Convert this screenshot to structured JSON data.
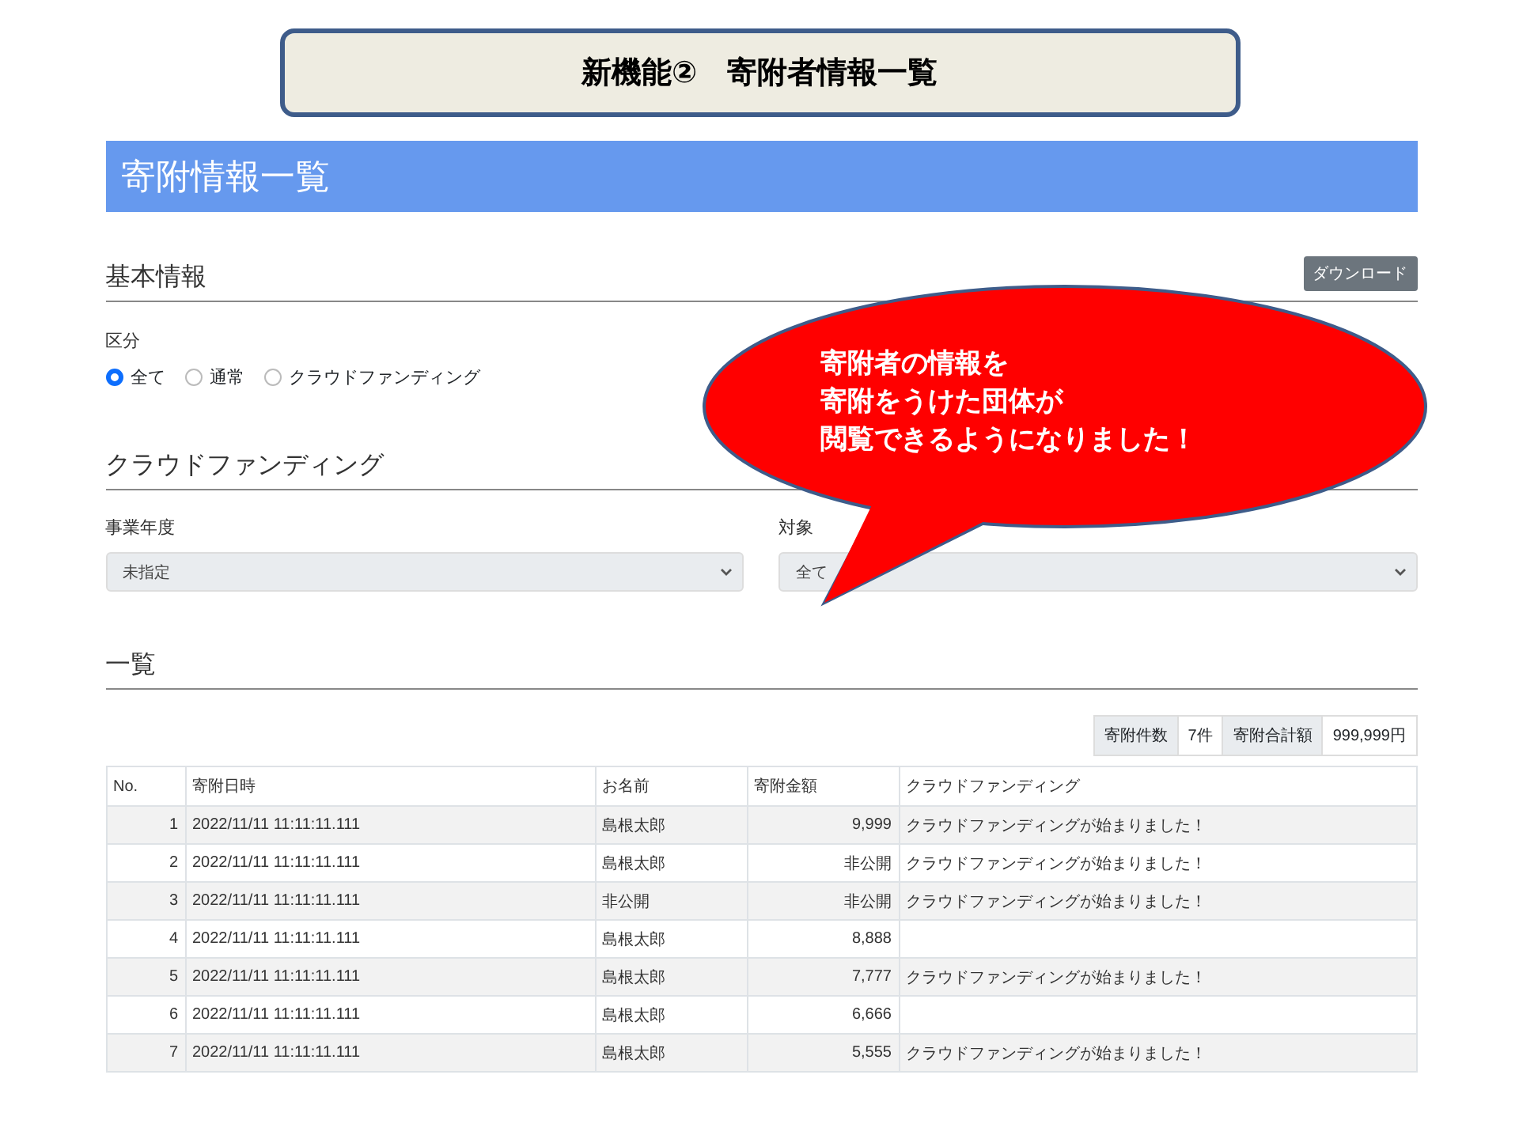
{
  "slide_title": "新機能②　寄附者情報一覧",
  "page": {
    "title": "寄附情報一覧"
  },
  "basic_info": {
    "heading": "基本情報",
    "download_button": "ダウンロード",
    "category_label": "区分",
    "options": [
      {
        "label": "全て",
        "selected": true
      },
      {
        "label": "通常",
        "selected": false
      },
      {
        "label": "クラウドファンディング",
        "selected": false
      }
    ]
  },
  "crowdfunding": {
    "heading": "クラウドファンディング",
    "selects": [
      {
        "label": "事業年度",
        "value": "未指定"
      },
      {
        "label": "対象",
        "value": "全て"
      }
    ]
  },
  "list": {
    "heading": "一覧",
    "summary": [
      {
        "label": "寄附件数",
        "value": "7件"
      },
      {
        "label": "寄附合計額",
        "value": "999,999円"
      }
    ],
    "columns": [
      "No.",
      "寄附日時",
      "お名前",
      "寄附金額",
      "クラウドファンディング"
    ],
    "rows": [
      {
        "no": "1",
        "datetime": "2022/11/11 11:11:11.111",
        "name": "島根太郎",
        "amount": "9,999",
        "message": "クラウドファンディングが始まりました！"
      },
      {
        "no": "2",
        "datetime": "2022/11/11 11:11:11.111",
        "name": "島根太郎",
        "amount": "非公開",
        "message": "クラウドファンディングが始まりました！"
      },
      {
        "no": "3",
        "datetime": "2022/11/11 11:11:11.111",
        "name": "非公開",
        "amount": "非公開",
        "message": "クラウドファンディングが始まりました！"
      },
      {
        "no": "4",
        "datetime": "2022/11/11 11:11:11.111",
        "name": "島根太郎",
        "amount": "8,888"
      },
      {
        "no": "5",
        "datetime": "2022/11/11 11:11:11.111",
        "name": "島根太郎",
        "amount": "7,777",
        "message": "クラウドファンディングが始まりました！"
      },
      {
        "no": "6",
        "datetime": "2022/11/11 11:11:11.111",
        "name": "島根太郎",
        "amount": "6,666"
      },
      {
        "no": "7",
        "datetime": "2022/11/11 11:11:11.111",
        "name": "島根太郎",
        "amount": "5,555",
        "message": "クラウドファンディングが始まりました！"
      }
    ]
  },
  "callout": {
    "lines": [
      "寄附者の情報を",
      "寄附をうけた団体が",
      "閲覧できるようになりました！"
    ]
  }
}
